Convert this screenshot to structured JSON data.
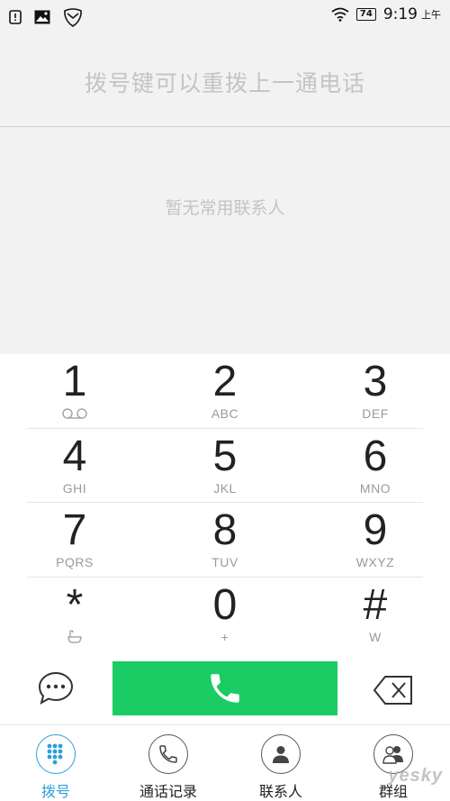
{
  "status_bar": {
    "icons_left": [
      "alert-icon",
      "image-icon",
      "shield-icon"
    ],
    "battery": "74",
    "time": "9:19",
    "ampm": "上午"
  },
  "hint_text": "拨号键可以重拨上一通电话",
  "empty_message": "暂无常用联系人",
  "keypad": [
    {
      "digit": "1",
      "letters": ""
    },
    {
      "digit": "2",
      "letters": "ABC"
    },
    {
      "digit": "3",
      "letters": "DEF"
    },
    {
      "digit": "4",
      "letters": "GHI"
    },
    {
      "digit": "5",
      "letters": "JKL"
    },
    {
      "digit": "6",
      "letters": "MNO"
    },
    {
      "digit": "7",
      "letters": "PQRS"
    },
    {
      "digit": "8",
      "letters": "TUV"
    },
    {
      "digit": "9",
      "letters": "WXYZ"
    },
    {
      "digit": "*",
      "letters": ""
    },
    {
      "digit": "0",
      "letters": "+"
    },
    {
      "digit": "#",
      "letters": "W"
    }
  ],
  "tabs": [
    {
      "label": "拨号",
      "icon": "dialpad-icon",
      "active": true
    },
    {
      "label": "通话记录",
      "icon": "phone-icon",
      "active": false
    },
    {
      "label": "联系人",
      "icon": "person-icon",
      "active": false
    },
    {
      "label": "群组",
      "icon": "group-icon",
      "active": false
    }
  ],
  "colors": {
    "call_green": "#1bcc64",
    "active_blue": "#2ba0d8"
  },
  "watermark": "yesky"
}
